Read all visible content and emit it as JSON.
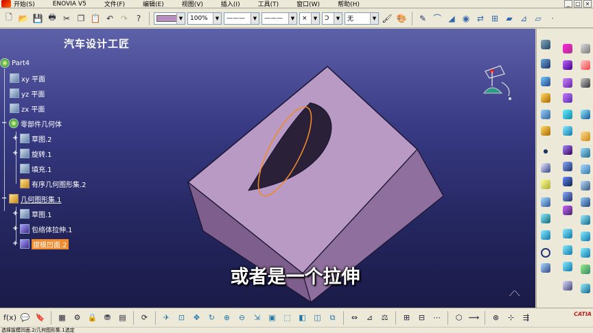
{
  "menubar": {
    "items": [
      "开始(S)",
      "ENOVIA V5",
      "文件(F)",
      "编辑(E)",
      "视图(V)",
      "插入(I)",
      "工具(T)",
      "窗口(W)",
      "帮助(H)"
    ],
    "window_controls": [
      "_",
      "□",
      "×"
    ]
  },
  "toolbar": {
    "icons": [
      "new-icon",
      "open-icon",
      "save-icon",
      "print-icon",
      "cut-icon",
      "copy-icon",
      "paste-icon",
      "undo-icon",
      "redo-icon",
      "whats-this-icon"
    ],
    "color_swatch": "#b78fbf",
    "transparency": "100%",
    "line_type": "———",
    "line_thickness": "———",
    "point_symbol": "×",
    "layer_icon": "Ↄ",
    "layer": "无"
  },
  "tree": {
    "root": "Part4",
    "nodes": [
      {
        "label": "xy 平面",
        "icon": "plane-icon"
      },
      {
        "label": "yz 平面",
        "icon": "plane-icon"
      },
      {
        "label": "zx 平面",
        "icon": "plane-icon"
      },
      {
        "label": "零部件几何体",
        "icon": "body-gear-icon"
      },
      {
        "label": "草图.2",
        "icon": "sketch-icon"
      },
      {
        "label": "旋转.1",
        "icon": "revolve-icon"
      },
      {
        "label": "填充.1",
        "icon": "fill-icon"
      },
      {
        "label": "有序几何图形集.2",
        "icon": "ordered-set-icon"
      },
      {
        "label": "几何图形集.1",
        "icon": "geometric-set-icon"
      },
      {
        "label": "草图.1",
        "icon": "sketch-icon"
      },
      {
        "label": "包络体拉伸.1",
        "icon": "volume-extrude-icon"
      },
      {
        "label": "拔模凹面.2",
        "icon": "draft-reflect-icon"
      }
    ]
  },
  "overlay": {
    "watermark": "汽车设计工匠",
    "subtitle": "或者是一个拉伸"
  },
  "colors": {
    "viewport_top": "#5d61a8",
    "viewport_bottom": "#1a1b47",
    "model_top_face": "#b89ac4",
    "model_side_face": "#9a7aa8",
    "ellipse_highlight": "#f08a2c",
    "tree_highlight": "#f08a2c"
  },
  "bottombar": {
    "icons": [
      "formula-icon",
      "comment-icon",
      "knowledge-icon",
      "table-icon",
      "macro-icon",
      "lock-icon",
      "sets-icon",
      "catalog-icon",
      "pan-icon",
      "fit-all-icon",
      "move-icon",
      "rotate-icon",
      "zoom-in-icon",
      "zoom-out-icon",
      "normal-view-icon",
      "iso-view-icon",
      "views-icon",
      "hide-show-icon",
      "swap-icon",
      "shading-icon",
      "axis-icon",
      "measure-icon",
      "apply-material-icon",
      "analysis-icon",
      "tools-icon"
    ],
    "catia_label": "CATIA"
  },
  "status": {
    "text": "选择拔模凹面.2/几何图形集.1选定"
  }
}
